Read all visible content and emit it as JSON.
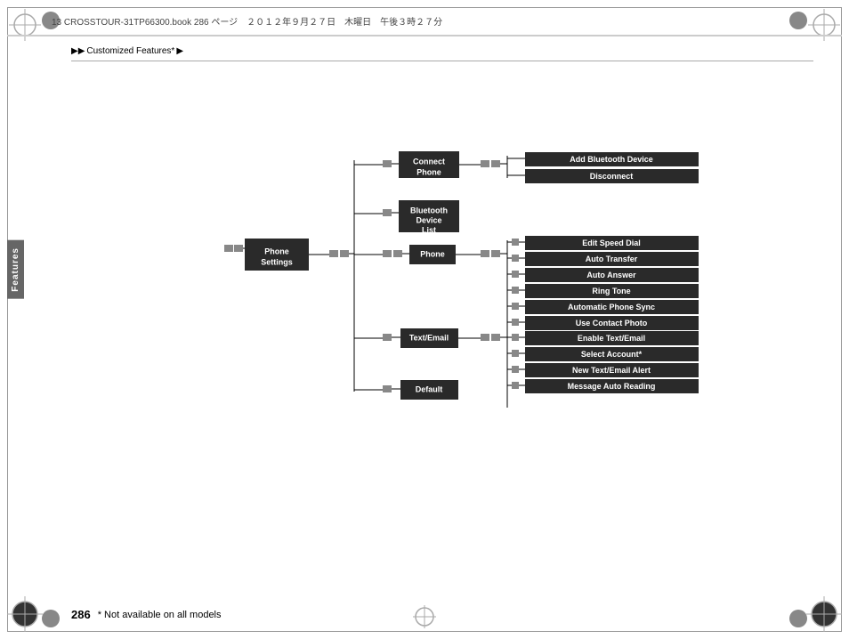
{
  "header": {
    "text": "13 CROSSTOUR-31TP66300.book  286 ページ　２０１２年９月２７日　木曜日　午後３時２７分"
  },
  "breadcrumb": {
    "items": [
      "▶▶",
      "Customized Features*",
      "▶"
    ]
  },
  "side_tab": {
    "label": "Features"
  },
  "diagram": {
    "root_node": "Phone Settings",
    "branches": [
      {
        "label": "Connect Phone",
        "children": [
          {
            "label": "Add Bluetooth Device"
          },
          {
            "label": "Disconnect"
          }
        ]
      },
      {
        "label": "Bluetooth Device List",
        "children": []
      },
      {
        "label": "Phone",
        "children": [
          {
            "label": "Edit Speed Dial"
          },
          {
            "label": "Auto Transfer"
          },
          {
            "label": "Auto Answer"
          },
          {
            "label": "Ring Tone"
          },
          {
            "label": "Automatic Phone Sync"
          },
          {
            "label": "Use Contact Photo"
          }
        ]
      },
      {
        "label": "Text/Email",
        "children": [
          {
            "label": "Enable Text/Email"
          },
          {
            "label": "Select Account*"
          },
          {
            "label": "New Text/Email Alert"
          },
          {
            "label": "Message Auto Reading"
          }
        ]
      },
      {
        "label": "Default",
        "children": []
      }
    ]
  },
  "footer": {
    "page_number": "286",
    "note": "* Not available on all models"
  },
  "colors": {
    "dark_box": "#2a2a2a",
    "medium_box": "#555",
    "light_box": "#888",
    "connector": "#000"
  }
}
